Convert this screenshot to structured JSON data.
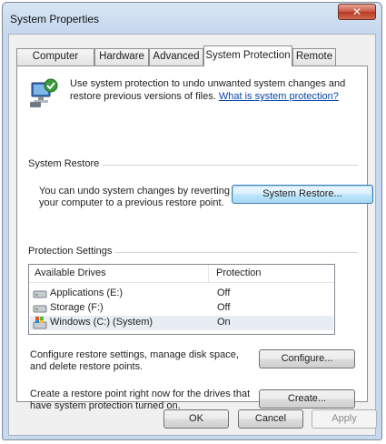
{
  "window": {
    "title": "System Properties",
    "close_glyph": "✕"
  },
  "tabs": [
    {
      "label": "Computer Name"
    },
    {
      "label": "Hardware"
    },
    {
      "label": "Advanced"
    },
    {
      "label": "System Protection"
    },
    {
      "label": "Remote"
    }
  ],
  "intro": {
    "icon": "system-protection-icon",
    "text": "Use system protection to undo unwanted system changes and restore previous versions of files.",
    "link": "What is system protection?"
  },
  "system_restore": {
    "group_title": "System Restore",
    "description_line1": "You can undo system changes by reverting",
    "description_line2": "your computer to a previous restore point.",
    "button": "System Restore..."
  },
  "protection": {
    "group_title": "Protection Settings",
    "columns": [
      "Available Drives",
      "Protection"
    ],
    "drives": [
      {
        "name": "Applications (E:)",
        "protection": "Off",
        "icon": "drive-icon"
      },
      {
        "name": "Storage (F:)",
        "protection": "Off",
        "icon": "drive-icon"
      },
      {
        "name": "Windows (C:) (System)",
        "protection": "On",
        "icon": "system-drive-icon"
      }
    ],
    "configure_line1": "Configure restore settings, manage disk space,",
    "configure_line2": "and delete restore points.",
    "configure_button": "Configure...",
    "create_line1": "Create a restore point right now for the drives that",
    "create_line2": "have system protection turned on.",
    "create_button": "Create..."
  },
  "footer": {
    "ok": "OK",
    "cancel": "Cancel",
    "apply": "Apply"
  }
}
